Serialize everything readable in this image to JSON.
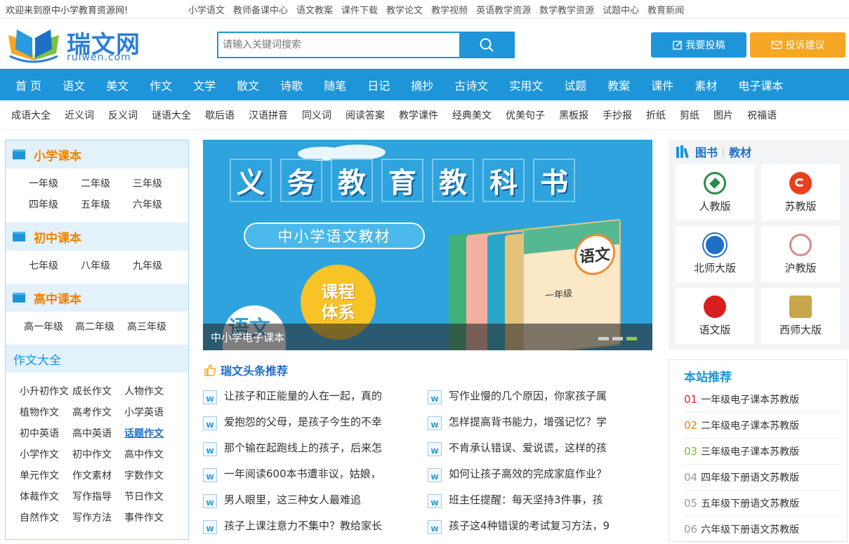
{
  "topbar": {
    "welcome": "欢迎来到原中小学教育资源网!",
    "links": [
      "小学语文",
      "教师备课中心",
      "语文教案",
      "课件下载",
      "教学论文",
      "教学视频",
      "英语教学资源",
      "数学教学资源",
      "试题中心",
      "教育新闻"
    ]
  },
  "header": {
    "logo_cn": "瑞文网",
    "logo_en": "ruiwen.com",
    "search_placeholder": "请输入关键词搜索",
    "btn_submit": "我要投稿",
    "btn_feedback": "投诉建议"
  },
  "nav_main": [
    "首 页",
    "语文",
    "美文",
    "作文",
    "文学",
    "散文",
    "诗歌",
    "随笔",
    "日记",
    "摘抄",
    "古诗文",
    "实用文",
    "试题",
    "教案",
    "课件",
    "素材",
    "电子课本"
  ],
  "nav_sub": [
    "成语大全",
    "近义词",
    "反义词",
    "谜语大全",
    "歇后语",
    "汉语拼音",
    "同义词",
    "阅读答案",
    "教学课件",
    "经典美文",
    "优美句子",
    "黑板报",
    "手抄报",
    "折纸",
    "剪纸",
    "图片",
    "祝福语"
  ],
  "sidebar": {
    "primary": {
      "title": "小学课本",
      "items": [
        "一年级",
        "二年级",
        "三年级",
        "四年级",
        "五年级",
        "六年级"
      ]
    },
    "middle": {
      "title": "初中课本",
      "items": [
        "七年级",
        "八年级",
        "九年级"
      ]
    },
    "high": {
      "title": "高中课本",
      "items": [
        "高一年级",
        "高二年级",
        "高三年级"
      ]
    },
    "essays": {
      "title": "作文大全",
      "items": [
        "小升初作文",
        "成长作文",
        "人物作文",
        "植物作文",
        "高考作文",
        "小学英语",
        "初中英语",
        "高中英语",
        "话题作文",
        "小学作文",
        "初中作文",
        "高中作文",
        "单元作文",
        "作文素材",
        "字数作文",
        "体裁作文",
        "写作指导",
        "节日作文",
        "自然作文",
        "写作方法",
        "事件作文"
      ],
      "highlighted": "话题作文"
    }
  },
  "banner": {
    "title_chars": [
      "义",
      "务",
      "教",
      "育",
      "教",
      "科",
      "书"
    ],
    "pill": "中小学语文教材",
    "circle_l1": "课程",
    "circle_l2": "体系",
    "book_word": "语文",
    "book_grade": "一年级",
    "caption": "中小学电子课本"
  },
  "recommend": {
    "title": "瑞文头条推荐",
    "left": [
      "让孩子和正能量的人在一起，真的",
      "爱抱怨的父母，是孩子今生的不幸",
      "那个输在起跑线上的孩子，后来怎",
      "一年阅读600本书遭非议，姑娘，",
      "男人眼里，这三种女人最难追",
      "孩子上课注意力不集中？教给家长"
    ],
    "right": [
      "写作业慢的几个原因，你家孩子属",
      "怎样提高背书能力，增强记忆？学",
      "不肯承认错误、爱说谎，这样的孩",
      "如何让孩子高效的完成家庭作业？",
      "班主任提醒：每天坚持3件事，孩",
      "孩子这4种错误的考试复习方法，9"
    ]
  },
  "books": {
    "tab1": "图书",
    "tab2": "教材",
    "items": [
      "人教版",
      "苏教版",
      "北师大版",
      "沪教版",
      "语文版",
      "西师大版"
    ]
  },
  "site_rec": {
    "title": "本站推荐",
    "items": [
      {
        "num": "01",
        "text": "一年级电子课本苏教版",
        "color": "#e02020"
      },
      {
        "num": "02",
        "text": "二年级电子课本苏教版",
        "color": "#f08300"
      },
      {
        "num": "03",
        "text": "三年级电子课本苏教版",
        "color": "#7cb82f"
      },
      {
        "num": "04",
        "text": "四年级下册语文苏教版",
        "color": "#999999"
      },
      {
        "num": "05",
        "text": "五年级下册语文苏教版",
        "color": "#999999"
      },
      {
        "num": "06",
        "text": "六年级下册语文苏教版",
        "color": "#999999"
      }
    ]
  },
  "colors": {
    "brand": "#1e95d9",
    "orange": "#f5a623"
  }
}
